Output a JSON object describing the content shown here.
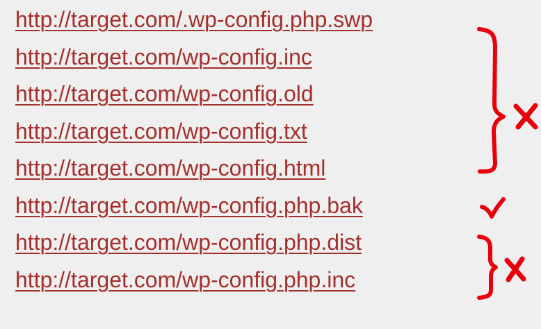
{
  "urls": [
    "http://target.com/.wp-config.php.swp",
    "http://target.com/wp-config.inc",
    "http://target.com/wp-config.old",
    "http://target.com/wp-config.txt",
    "http://target.com/wp-config.html",
    "http://target.com/wp-config.php.bak",
    "http://target.com/wp-config.php.dist",
    "http://target.com/wp-config.php.inc"
  ],
  "colors": {
    "background": "#efefef",
    "link": "#a3302c",
    "annotation": "#e8000b"
  },
  "annotations": {
    "group_1": {
      "covers": [
        0,
        4
      ],
      "mark": "cross"
    },
    "single": {
      "covers": [
        5
      ],
      "mark": "check"
    },
    "group_2": {
      "covers": [
        6,
        7
      ],
      "mark": "cross"
    }
  }
}
